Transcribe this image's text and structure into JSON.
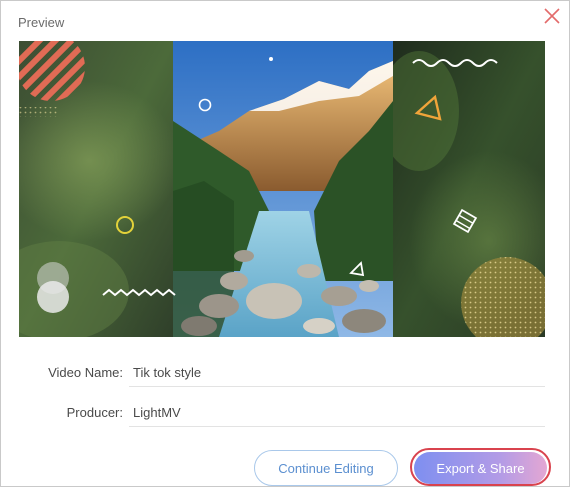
{
  "dialog": {
    "title": "Preview"
  },
  "preview": {
    "description_icon": "landscape-video-frame"
  },
  "fields": {
    "video_name_label": "Video Name:",
    "video_name_value": "Tik tok style",
    "producer_label": "Producer:",
    "producer_value": "LightMV"
  },
  "buttons": {
    "continue_label": "Continue Editing",
    "export_label": "Export & Share"
  },
  "colors": {
    "close_icon": "#e36b6b",
    "continue_border": "#a9c8ea",
    "continue_text": "#5b8fd0",
    "export_highlight": "#d9434e",
    "export_gradient_start": "#7e8ff0",
    "export_gradient_end": "#e4a7d3"
  }
}
